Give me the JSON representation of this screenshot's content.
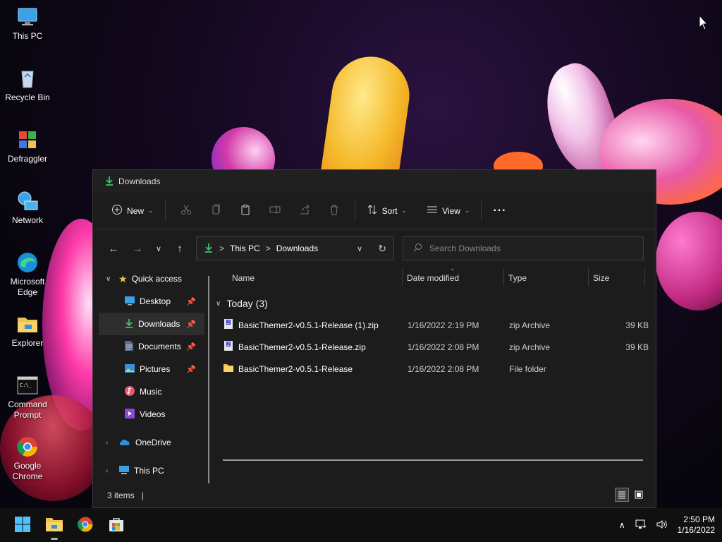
{
  "desktop": {
    "icons": [
      {
        "label": "This PC",
        "icon": "monitor-icon"
      },
      {
        "label": "Recycle Bin",
        "icon": "recycle-bin-icon"
      },
      {
        "label": "Defraggler",
        "icon": "defraggler-icon"
      },
      {
        "label": "Network",
        "icon": "network-icon"
      },
      {
        "label": "Microsoft Edge",
        "icon": "edge-icon"
      },
      {
        "label": "Explorer",
        "icon": "folder-icon"
      },
      {
        "label": "Command Prompt",
        "icon": "cmd-icon"
      },
      {
        "label": "Google Chrome",
        "icon": "chrome-icon"
      }
    ]
  },
  "window": {
    "title": "Downloads",
    "toolbar": {
      "new_label": "New",
      "sort_label": "Sort",
      "view_label": "View",
      "more_label": "···"
    },
    "address": {
      "segments": [
        "This PC",
        "Downloads"
      ],
      "separator": ">"
    },
    "search": {
      "placeholder": "Search Downloads"
    },
    "nav_pane": {
      "quick_access": "Quick access",
      "items": [
        {
          "label": "Desktop",
          "pinned": true,
          "icon": "desktop-icon"
        },
        {
          "label": "Downloads",
          "pinned": true,
          "icon": "download-icon",
          "selected": true
        },
        {
          "label": "Documents",
          "pinned": true,
          "icon": "documents-icon"
        },
        {
          "label": "Pictures",
          "pinned": true,
          "icon": "pictures-icon"
        },
        {
          "label": "Music",
          "pinned": false,
          "icon": "music-icon"
        },
        {
          "label": "Videos",
          "pinned": false,
          "icon": "videos-icon"
        }
      ],
      "onedrive": "OneDrive",
      "this_pc": "This PC"
    },
    "columns": [
      "Name",
      "Date modified",
      "Type",
      "Size"
    ],
    "group_label": "Today (3)",
    "files": [
      {
        "name": "BasicThemer2-v0.5.1-Release (1).zip",
        "date": "1/16/2022 2:19 PM",
        "type": "zip Archive",
        "size": "39 KB",
        "icon": "zip-icon"
      },
      {
        "name": "BasicThemer2-v0.5.1-Release.zip",
        "date": "1/16/2022 2:08 PM",
        "type": "zip Archive",
        "size": "39 KB",
        "icon": "zip-icon"
      },
      {
        "name": "BasicThemer2-v0.5.1-Release",
        "date": "1/16/2022 2:08 PM",
        "type": "File folder",
        "size": "",
        "icon": "folder-icon"
      }
    ],
    "status": "3 items"
  },
  "taskbar": {
    "time": "2:50 PM",
    "date": "1/16/2022"
  },
  "colors": {
    "accent_green": "#3fbf6f",
    "folder_yellow": "#f2c14e",
    "window_bg": "#1c1c1c"
  }
}
